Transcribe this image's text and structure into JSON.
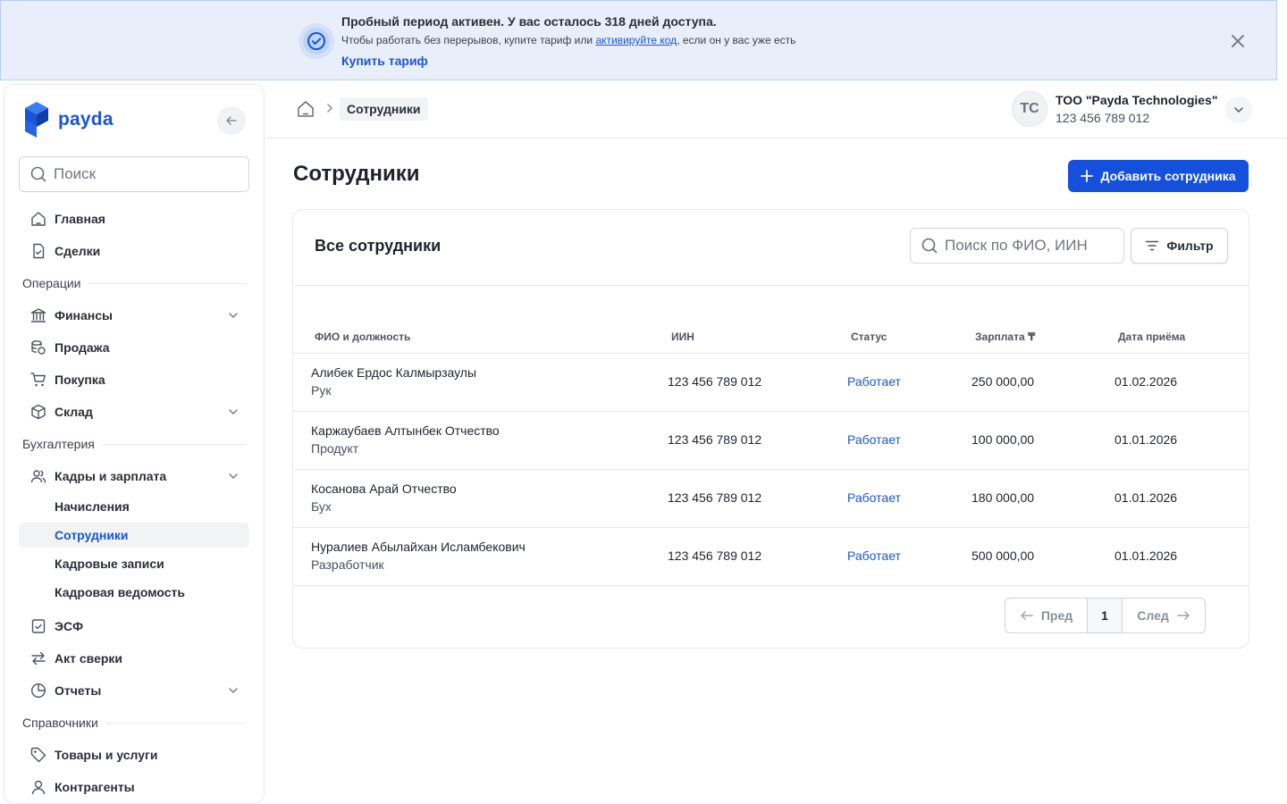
{
  "banner": {
    "title": "Пробный период активен. У вас осталось 318 дней доступа.",
    "text_before": "Чтобы работать без перерывов, купите тариф или ",
    "link_text": "активируйте код",
    "text_after": ", если он у вас уже есть",
    "cta": "Купить тариф"
  },
  "sidebar": {
    "logo": "payda",
    "search_placeholder": "Поиск",
    "items": {
      "home": "Главная",
      "deals": "Сделки",
      "section_operations": "Операции",
      "finance": "Финансы",
      "sales": "Продажа",
      "purchase": "Покупка",
      "warehouse": "Склад",
      "section_accounting": "Бухгалтерия",
      "hr": "Кадры и зарплата",
      "accruals": "Начисления",
      "employees": "Сотрудники",
      "hr_records": "Кадровые записи",
      "hr_statement": "Кадровая ведомость",
      "esf": "ЭСФ",
      "reconciliation": "Акт сверки",
      "reports": "Отчеты",
      "section_references": "Справочники",
      "goods": "Товары и услуги",
      "counterparties": "Контрагенты"
    }
  },
  "header": {
    "breadcrumb": "Сотрудники",
    "avatar_initials": "ТС",
    "org_name": "ТОО \"Payda Technologies\"",
    "org_id": "123 456 789 012"
  },
  "main": {
    "title": "Сотрудники",
    "add_button": "Добавить сотрудника",
    "card_title": "Все сотрудники",
    "search_placeholder": "Поиск по ФИО, ИИН",
    "filter_button": "Фильтр",
    "columns": [
      "ФИО и должность",
      "ИИН",
      "Статус",
      "Зарплата ₸",
      "Дата приёма"
    ],
    "rows": [
      {
        "name": "Алибек Ердос Калмырзаулы",
        "position": "Рук",
        "iin": "123 456 789 012",
        "status": "Работает",
        "salary": "250 000,00",
        "date": "01.02.2026"
      },
      {
        "name": "Каржаубаев Алтынбек Отчество",
        "position": "Продукт",
        "iin": "123 456 789 012",
        "status": "Работает",
        "salary": "100 000,00",
        "date": "01.01.2026"
      },
      {
        "name": "Косанова Арай Отчество",
        "position": "Бух",
        "iin": "123 456 789 012",
        "status": "Работает",
        "salary": "180 000,00",
        "date": "01.01.2026"
      },
      {
        "name": "Нуралиев Абылайхан Исламбекович",
        "position": "Разработчик",
        "iin": "123 456 789 012",
        "status": "Работает",
        "salary": "500 000,00",
        "date": "01.01.2026"
      }
    ],
    "pager": {
      "prev": "Пред",
      "page": "1",
      "next": "След"
    }
  }
}
